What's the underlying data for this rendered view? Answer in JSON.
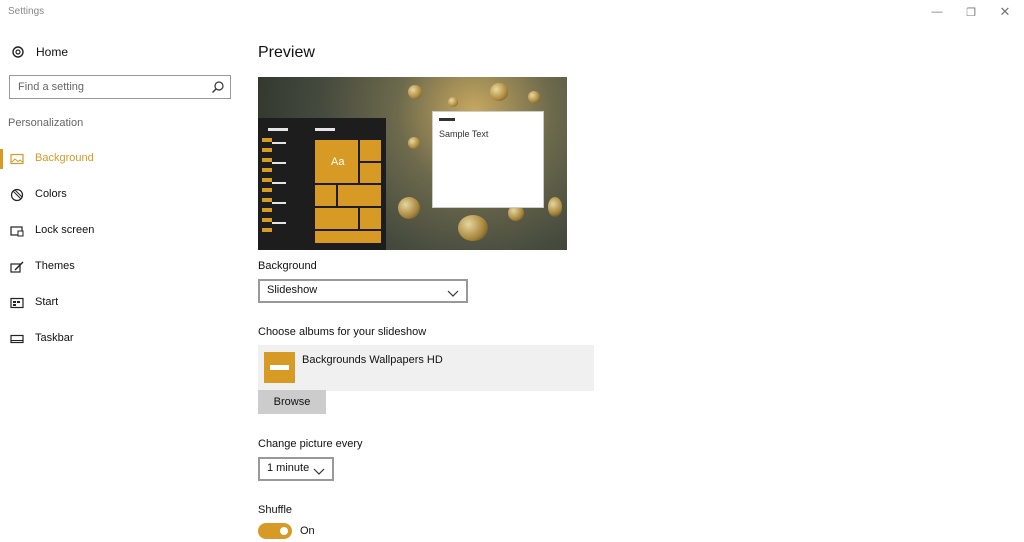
{
  "window": {
    "title": "Settings",
    "controls": {
      "minimize": "—",
      "maximize": "❐",
      "close": "✕"
    }
  },
  "sidebar": {
    "home": {
      "label": "Home",
      "icon": "gear-icon"
    },
    "search": {
      "placeholder": "Find a setting",
      "icon": "search-icon"
    },
    "section_label": "Personalization",
    "items": [
      {
        "label": "Background",
        "icon": "picture-icon",
        "active": true
      },
      {
        "label": "Colors",
        "icon": "palette-icon",
        "active": false
      },
      {
        "label": "Lock screen",
        "icon": "lock-screen-icon",
        "active": false
      },
      {
        "label": "Themes",
        "icon": "brush-icon",
        "active": false
      },
      {
        "label": "Start",
        "icon": "start-icon",
        "active": false
      },
      {
        "label": "Taskbar",
        "icon": "taskbar-icon",
        "active": false
      }
    ]
  },
  "main": {
    "preview_title": "Preview",
    "preview": {
      "sample_text": "Sample Text",
      "tile_text": "Aa"
    },
    "background": {
      "label": "Background",
      "value": "Slideshow"
    },
    "albums": {
      "label": "Choose albums for your slideshow",
      "items": [
        {
          "name": "Backgrounds Wallpapers HD"
        }
      ],
      "browse_label": "Browse"
    },
    "change_picture": {
      "label": "Change picture every",
      "value": "1 minute"
    },
    "shuffle": {
      "label": "Shuffle",
      "state": "On",
      "on": true
    }
  },
  "colors": {
    "accent": "#d69a25"
  }
}
